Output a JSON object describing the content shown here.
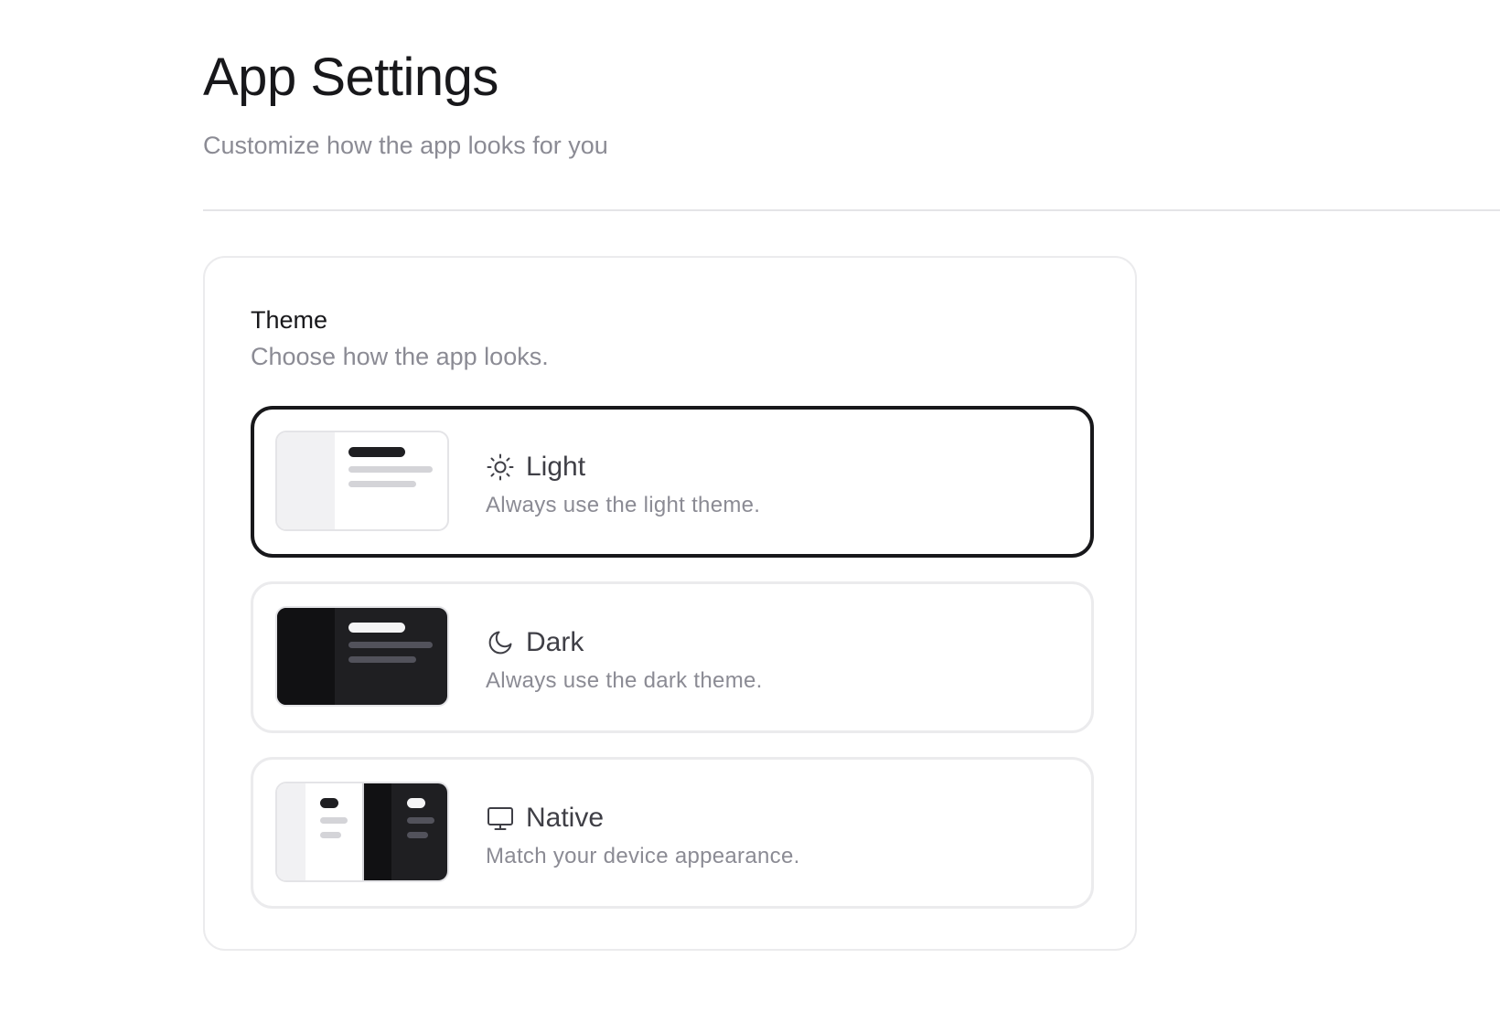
{
  "header": {
    "title": "App Settings",
    "subtitle": "Customize how the app looks for you"
  },
  "theme_section": {
    "title": "Theme",
    "description": "Choose how the app looks.",
    "selected": "light",
    "options": [
      {
        "id": "light",
        "label": "Light",
        "description": "Always use the light theme.",
        "icon": "sun-icon"
      },
      {
        "id": "dark",
        "label": "Dark",
        "description": "Always use the dark theme.",
        "icon": "moon-icon"
      },
      {
        "id": "native",
        "label": "Native",
        "description": "Match your device appearance.",
        "icon": "monitor-icon"
      }
    ]
  },
  "colors": {
    "selected_border": "#18181b",
    "border": "#ebebed",
    "muted_text": "#8b8b94",
    "dark_preview": "#1f1f22"
  }
}
